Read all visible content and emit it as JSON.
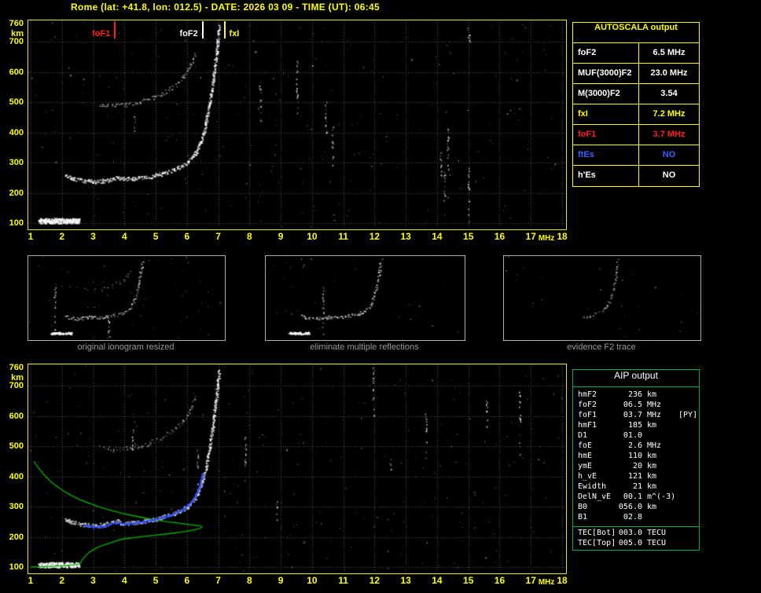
{
  "title": "Rome (lat: +41.8, lon: 012.5) - DATE: 2026 03 09 - TIME (UT): 06:45",
  "colors": {
    "background": "#000000",
    "axis": "#ffff00",
    "plot_border": "#e8e800",
    "trace": "#ffffff",
    "foF1_marker": "#ff2020",
    "foF2_marker": "#ffffff",
    "fxI_marker": "#ffff00",
    "ftEs_text": "#3a5fff",
    "aip_border": "#00b050",
    "profile_green": "#00b400",
    "restored_blue": "#2b46ff",
    "caption_gray": "#9a9a9a"
  },
  "autoscala_table": {
    "header": "AUTOSCALA output",
    "rows": [
      {
        "label": "foF2",
        "value": "6.5 MHz",
        "color": "#ffffff"
      },
      {
        "label": "MUF(3000)F2",
        "value": "23.0 MHz",
        "color": "#ffffff"
      },
      {
        "label": "M(3000)F2",
        "value": "3.54",
        "color": "#ffffff"
      },
      {
        "label": "fxI",
        "value": "7.2 MHz",
        "color": "#ffff00"
      },
      {
        "label": "foF1",
        "value": "3.7 MHz",
        "color": "#ff2020"
      },
      {
        "label": "ftEs",
        "value": "NO",
        "color": "#3a5fff"
      },
      {
        "label": "h'Es",
        "value": "NO",
        "color": "#ffffff"
      }
    ]
  },
  "panels": [
    {
      "caption": "original ionogram resized"
    },
    {
      "caption": "eliminate multiple reflections"
    },
    {
      "caption": "evidence F2 trace"
    }
  ],
  "aip_table": {
    "header": "AIP output",
    "rows": [
      {
        "label": "hmF2",
        "value": "236",
        "unit": "km"
      },
      {
        "label": "foF2",
        "value": "06.5",
        "unit": "MHz"
      },
      {
        "label": "foF1",
        "value": "03.7",
        "unit": "MHz",
        "note": "[PY]"
      },
      {
        "label": "hmF1",
        "value": "185",
        "unit": "km"
      },
      {
        "label": "D1",
        "value": "01.0",
        "unit": ""
      },
      {
        "label": "foE",
        "value": "2.6",
        "unit": "MHz"
      },
      {
        "label": "hmE",
        "value": "110",
        "unit": "km"
      },
      {
        "label": "ymE",
        "value": "20",
        "unit": "km"
      },
      {
        "label": "h_vE",
        "value": "121",
        "unit": "km"
      },
      {
        "label": "Ewidth",
        "value": "21",
        "unit": "km"
      },
      {
        "label": "DelN_vE",
        "value": "00.1",
        "unit": "m^(-3)"
      },
      {
        "label": "B0",
        "value": "056.0",
        "unit": "km"
      },
      {
        "label": "B1",
        "value": "02.8",
        "unit": ""
      }
    ],
    "tec_rows": [
      {
        "label": "TEC[Bot]",
        "value": "003.0",
        "unit": "TECU"
      },
      {
        "label": "TEC[Top]",
        "value": "005.0",
        "unit": "TECU"
      }
    ]
  },
  "chart_data": [
    {
      "type": "scatter",
      "title": "recorded ionogram with autoscaled characteristic frequencies",
      "xlabel": "MHz",
      "ylabel": "km",
      "xlim": [
        1,
        18
      ],
      "ylim": [
        100,
        760
      ],
      "grid": true,
      "xticks": [
        1,
        2,
        3,
        4,
        5,
        6,
        7,
        8,
        9,
        10,
        11,
        12,
        13,
        14,
        15,
        16,
        17,
        18
      ],
      "yticks": [
        760,
        700,
        600,
        500,
        400,
        300,
        200,
        100
      ],
      "markers": [
        {
          "label": "foF1",
          "freq_mhz": 3.7,
          "color": "#ff2020"
        },
        {
          "label": "foF2",
          "freq_mhz": 6.5,
          "color": "#ffffff"
        },
        {
          "label": "fxI",
          "freq_mhz": 7.2,
          "color": "#ffff00"
        }
      ],
      "series": [
        {
          "name": "E-region echo (~100-115 km, 1.3-2.5 MHz)",
          "points": [
            [
              1.3,
              104
            ],
            [
              1.6,
              106
            ],
            [
              1.9,
              108
            ],
            [
              2.2,
              110
            ],
            [
              2.45,
              113
            ]
          ]
        },
        {
          "name": "F-trace first hop",
          "points": [
            [
              2.1,
              262
            ],
            [
              2.3,
              250
            ],
            [
              2.6,
              242
            ],
            [
              3.0,
              238
            ],
            [
              3.3,
              240
            ],
            [
              3.6,
              247
            ],
            [
              3.75,
              254
            ],
            [
              3.9,
              246
            ],
            [
              4.3,
              248
            ],
            [
              4.8,
              255
            ],
            [
              5.2,
              264
            ],
            [
              5.6,
              278
            ],
            [
              6.0,
              300
            ],
            [
              6.25,
              330
            ],
            [
              6.45,
              375
            ],
            [
              6.6,
              430
            ],
            [
              6.72,
              500
            ],
            [
              6.82,
              570
            ],
            [
              6.9,
              640
            ],
            [
              6.97,
              700
            ],
            [
              7.02,
              752
            ]
          ]
        },
        {
          "name": "F-trace second hop",
          "points": [
            [
              3.2,
              495
            ],
            [
              3.6,
              490
            ],
            [
              4.0,
              492
            ],
            [
              4.4,
              500
            ],
            [
              4.8,
              512
            ],
            [
              5.2,
              530
            ],
            [
              5.6,
              556
            ],
            [
              5.9,
              590
            ],
            [
              6.1,
              625
            ],
            [
              6.25,
              660
            ]
          ]
        }
      ]
    },
    {
      "type": "scatter+line",
      "title": "ionogram with restored trace and electron density profile",
      "xlabel": "MHz",
      "ylabel": "km",
      "xlim": [
        1,
        18
      ],
      "ylim": [
        100,
        760
      ],
      "grid": true,
      "xticks": [
        1,
        2,
        3,
        4,
        5,
        6,
        7,
        8,
        9,
        10,
        11,
        12,
        13,
        14,
        15,
        16,
        17,
        18
      ],
      "yticks": [
        760,
        700,
        600,
        500,
        400,
        300,
        200,
        100
      ],
      "series": [
        {
          "name": "E-region echo",
          "points": [
            [
              1.3,
              104
            ],
            [
              1.6,
              106
            ],
            [
              1.9,
              108
            ],
            [
              2.2,
              110
            ],
            [
              2.45,
              113
            ]
          ]
        },
        {
          "name": "F-trace first hop",
          "points": [
            [
              2.1,
              262
            ],
            [
              2.3,
              250
            ],
            [
              2.6,
              242
            ],
            [
              3.0,
              238
            ],
            [
              3.3,
              240
            ],
            [
              3.6,
              247
            ],
            [
              3.75,
              254
            ],
            [
              3.9,
              246
            ],
            [
              4.3,
              248
            ],
            [
              4.8,
              255
            ],
            [
              5.2,
              264
            ],
            [
              5.6,
              278
            ],
            [
              6.0,
              300
            ],
            [
              6.25,
              330
            ],
            [
              6.45,
              375
            ],
            [
              6.6,
              430
            ],
            [
              6.72,
              500
            ],
            [
              6.82,
              570
            ],
            [
              6.9,
              640
            ],
            [
              6.97,
              700
            ],
            [
              7.02,
              752
            ]
          ]
        },
        {
          "name": "F-trace second hop",
          "points": [
            [
              3.2,
              495
            ],
            [
              3.6,
              490
            ],
            [
              4.0,
              492
            ],
            [
              4.4,
              500
            ],
            [
              4.8,
              512
            ],
            [
              5.2,
              530
            ],
            [
              5.6,
              556
            ],
            [
              5.9,
              590
            ],
            [
              6.1,
              625
            ],
            [
              6.25,
              660
            ]
          ]
        }
      ],
      "profile": {
        "name": "electron density profile (plasma frequency vs height)",
        "color": "#00b400",
        "points": [
          [
            1.1,
            450
          ],
          [
            1.4,
            405
          ],
          [
            1.9,
            360
          ],
          [
            2.6,
            320
          ],
          [
            3.6,
            285
          ],
          [
            4.8,
            258
          ],
          [
            5.9,
            243
          ],
          [
            6.5,
            236
          ],
          [
            6.45,
            228
          ],
          [
            6.0,
            218
          ],
          [
            5.2,
            208
          ],
          [
            4.4,
            199
          ],
          [
            3.9,
            192
          ],
          [
            3.7,
            185
          ],
          [
            3.5,
            178
          ],
          [
            3.2,
            168
          ],
          [
            2.95,
            155
          ],
          [
            2.8,
            142
          ],
          [
            2.7,
            130
          ],
          [
            2.62,
            121
          ],
          [
            2.6,
            110
          ],
          [
            2.4,
            107
          ],
          [
            2.0,
            104
          ],
          [
            1.5,
            102
          ],
          [
            1.0,
            100
          ]
        ]
      },
      "restored_trace": {
        "name": "restored h'(f) trace",
        "color": "#2b46ff",
        "points": [
          [
            2.7,
            240
          ],
          [
            3.0,
            232
          ],
          [
            3.4,
            236
          ],
          [
            3.7,
            248
          ],
          [
            4.0,
            242
          ],
          [
            4.5,
            248
          ],
          [
            5.0,
            258
          ],
          [
            5.5,
            272
          ],
          [
            5.9,
            292
          ],
          [
            6.2,
            320
          ],
          [
            6.4,
            360
          ],
          [
            6.5,
            410
          ]
        ]
      }
    }
  ]
}
